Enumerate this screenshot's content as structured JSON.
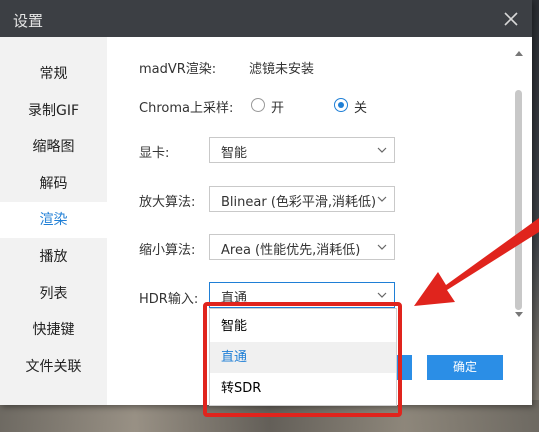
{
  "window": {
    "title": "设置"
  },
  "sidebar": {
    "items": [
      {
        "label": "常规",
        "active": false
      },
      {
        "label": "录制GIF",
        "active": false
      },
      {
        "label": "缩略图",
        "active": false
      },
      {
        "label": "解码",
        "active": false
      },
      {
        "label": "渲染",
        "active": true
      },
      {
        "label": "播放",
        "active": false
      },
      {
        "label": "列表",
        "active": false
      },
      {
        "label": "快捷键",
        "active": false
      },
      {
        "label": "文件关联",
        "active": false
      }
    ]
  },
  "render": {
    "madvr_label": "madVR渲染:",
    "madvr_value": "滤镜未安装",
    "chroma_label": "Chroma上采样:",
    "chroma_on": "开",
    "chroma_off": "关",
    "chroma_selected": "关",
    "gpu_label": "显卡:",
    "gpu_value": "智能",
    "upscale_label": "放大算法:",
    "upscale_value": "Blinear (色彩平滑,消耗低)",
    "downscale_label": "缩小算法:",
    "downscale_value": "Area (性能优先,消耗低)",
    "hdr_label": "HDR输入:",
    "hdr_value": "直通"
  },
  "hdr_dropdown": {
    "options": [
      "智能",
      "直通",
      "转SDR"
    ],
    "highlighted": "直通"
  },
  "buttons": {
    "ok": "确定"
  },
  "colors": {
    "accent": "#1f7fd6",
    "annotation": "#e0241d",
    "titlebar": "#3c3f44"
  }
}
